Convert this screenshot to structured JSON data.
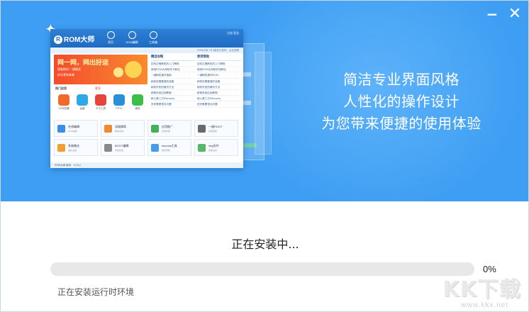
{
  "window": {
    "controls": {
      "minimize": "−",
      "close": "✕"
    }
  },
  "banner": {
    "slogan": [
      "简洁专业界面风格",
      "人性化的操作设计",
      "为您带来便捷的使用体验"
    ],
    "background_color": "#3e9ef3"
  },
  "preview": {
    "app_name": "ROM大师",
    "nav": [
      "首页",
      "ROM编辑",
      "工具箱"
    ],
    "account": "注册  登录",
    "strip": "ROM大师 1.5.4版本已发布，点击查看",
    "ad": {
      "title": "网一网，网出好运",
      "line1": "智能刷机 一键搞定",
      "line2": "好礼等你来拿"
    },
    "apps_title": "热门应用",
    "apps_more": "更多",
    "apps": [
      {
        "name": "VC浏览器",
        "color": "#f26a2a"
      },
      {
        "name": "运营",
        "color": "#2fa8e6"
      },
      {
        "name": "卡卡工具",
        "color": "#e6453c"
      },
      {
        "name": "PPTV",
        "color": "#2a8fd9"
      },
      {
        "name": "微信",
        "color": "#3cbf4a"
      }
    ],
    "col1": {
      "title": "精选攻略",
      "rows": [
        "如何正确刷机的入门教程",
        "使用ROM大师制作卡刷包",
        "一键刷机操作指南",
        "刷机前需要做的准备",
        "刷机失败的解决方法",
        "精简系统应用教程",
        "刷入第三方Recovery",
        "进来看看常见问题"
      ]
    },
    "col2": {
      "title": "使用帮助",
      "rows": [
        "如何正确刷机的入门教程",
        "使用ROM大师制作线刷包",
        "一键刷机操作ROM",
        "刷机前需要做的准备",
        "刷机失败的解决方法",
        "精简系统应用教程",
        "刷入第三方Recovery",
        "进来看看常见问题"
      ]
    },
    "tiles": [
      {
        "title": "在线编辑",
        "sub": "ROM编辑",
        "color": "#3a8ee6"
      },
      {
        "title": "深度精简",
        "sub": "精简系统",
        "color": "#f08a30"
      },
      {
        "title": "应用推广",
        "sub": "应用管理",
        "color": "#45b058"
      },
      {
        "title": "一键ROOT",
        "sub": "获取权限",
        "color": "#6a6a6a"
      },
      {
        "title": "系统美化",
        "sub": "美化主题",
        "color": "#f0a030"
      },
      {
        "title": "BOOT编辑",
        "sub": "内核修改",
        "color": "#8a8a8a"
      },
      {
        "title": "new.dat工具",
        "sub": "格式转换",
        "color": "#4a9be8"
      },
      {
        "title": "img合并",
        "sub": "镜像合并",
        "color": "#58b868"
      }
    ],
    "status": "ROM大师  版本：V1.5.4"
  },
  "install": {
    "status_title": "正在安装中...",
    "progress_percent": 0,
    "progress_label": "0%",
    "status_detail": "正在安装运行时环境"
  },
  "watermark": {
    "logo": "KK下载",
    "url": "www.kkx.net"
  }
}
